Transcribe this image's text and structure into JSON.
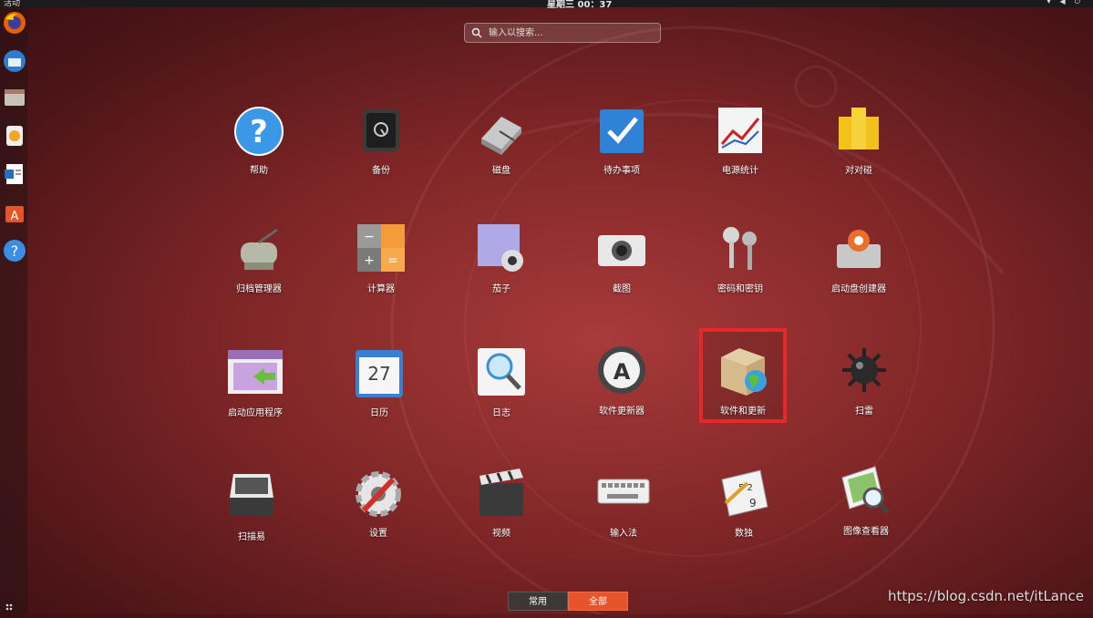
{
  "topbar": {
    "activities": "活动",
    "clock": "星期三 00：37",
    "tray_icons": [
      "network-icon",
      "volume-icon",
      "power-icon"
    ]
  },
  "search": {
    "placeholder": "输入以搜索..."
  },
  "apps": [
    {
      "label": "帮助",
      "icon": "help-icon"
    },
    {
      "label": "备份",
      "icon": "safe-icon"
    },
    {
      "label": "磁盘",
      "icon": "disk-icon"
    },
    {
      "label": "待办事项",
      "icon": "checkmark-icon"
    },
    {
      "label": "电源统计",
      "icon": "chart-icon"
    },
    {
      "label": "对对碰",
      "icon": "swell-foop-icon"
    },
    {
      "label": "归档管理器",
      "icon": "archive-roller-icon"
    },
    {
      "label": "计算器",
      "icon": "calculator-icon"
    },
    {
      "label": "茄子",
      "icon": "cheese-webcam-icon"
    },
    {
      "label": "截图",
      "icon": "camera-icon"
    },
    {
      "label": "密码和密钥",
      "icon": "keys-icon"
    },
    {
      "label": "启动盘创建器",
      "icon": "usb-creator-icon"
    },
    {
      "label": "启动应用程序",
      "icon": "startup-apps-icon"
    },
    {
      "label": "日历",
      "icon": "calendar-icon",
      "calendar_day": "27"
    },
    {
      "label": "日志",
      "icon": "log-magnifier-icon"
    },
    {
      "label": "软件更新器",
      "icon": "software-updater-icon"
    },
    {
      "label": "软件和更新",
      "icon": "software-properties-icon"
    },
    {
      "label": "扫雷",
      "icon": "mine-icon"
    },
    {
      "label": "扫描易",
      "icon": "scanner-icon"
    },
    {
      "label": "设置",
      "icon": "settings-gear-icon"
    },
    {
      "label": "视频",
      "icon": "clapperboard-icon"
    },
    {
      "label": "输入法",
      "icon": "keyboard-icon"
    },
    {
      "label": "数独",
      "icon": "sudoku-icon"
    },
    {
      "label": "图像查看器",
      "icon": "image-viewer-icon"
    }
  ],
  "highlighted_app": "软件和更新",
  "switcher": {
    "frequent": "常用",
    "all": "全部",
    "active": "全部"
  },
  "watermark": "https://blog.csdn.net/itLance",
  "colors": {
    "accent": "#e8542a",
    "highlight_border": "#e8272a",
    "background": "#7d2526"
  }
}
